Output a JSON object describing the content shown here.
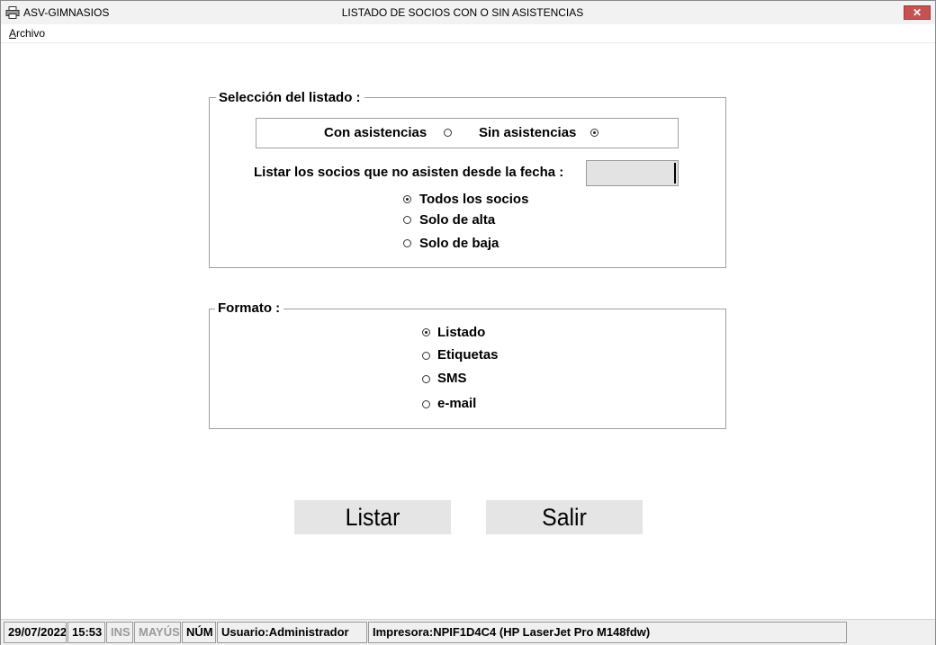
{
  "window": {
    "app_name": "ASV-GIMNASIOS",
    "title": "LISTADO DE SOCIOS CON O SIN ASISTENCIAS",
    "close_glyph": "✕"
  },
  "menu": {
    "archivo_first": "A",
    "archivo_rest": "rchivo"
  },
  "seleccion": {
    "legend": "Selección del listado :",
    "con_label": "Con asistencias",
    "sin_label": "Sin asistencias",
    "asistencias_selected": "sin",
    "fecha_label": "Listar los socios que no asisten desde la fecha :",
    "fecha_value": "",
    "options": [
      "Todos los socios",
      "Solo de alta",
      "Solo de baja"
    ],
    "selected_option": 0
  },
  "formato": {
    "legend": "Formato :",
    "options": [
      "Listado",
      "Etiquetas",
      "SMS",
      "e-mail"
    ],
    "selected_option": 0
  },
  "buttons": {
    "listar": "Listar",
    "salir": "Salir"
  },
  "status": {
    "date": "29/07/2022",
    "time": "15:53",
    "ins": "INS",
    "mayus": "MAYÚS",
    "num": "NÚM",
    "user": "Usuario:Administrador",
    "printer": "Impresora:NPIF1D4C4 (HP LaserJet Pro M148fdw)"
  },
  "icons": {
    "app": "printer-icon",
    "close": "close-icon"
  },
  "colors": {
    "close_button": "#c75050",
    "titlebar": "#f2f2f2",
    "button_bg": "#e5e5e5"
  }
}
